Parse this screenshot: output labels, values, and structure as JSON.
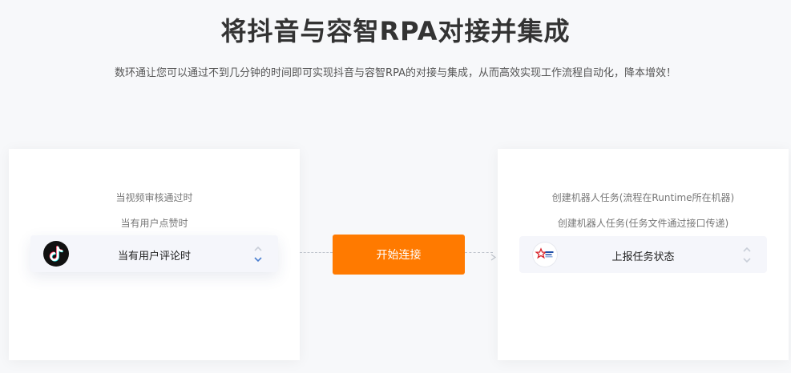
{
  "header": {
    "title": "将抖音与容智RPA对接并集成",
    "subtitle": "数环通让您可以通过不到几分钟的时间即可实现抖音与容智RPA的对接与集成，从而高效实现工作流程自动化，降本增效！"
  },
  "trigger_panel": {
    "options": [
      "当视频审核通过时",
      "当有用户点赞时"
    ],
    "selected": {
      "label": "当有用户评论时",
      "icon": "tiktok-icon"
    }
  },
  "connect_button": {
    "label": "开始连接",
    "color": "#ff7a00"
  },
  "action_panel": {
    "options": [
      "创建机器人任务(流程在Runtime所在机器)",
      "创建机器人任务(任务文件通过接口传递)"
    ],
    "selected": {
      "label": "上报任务状态",
      "icon": "robot-icon"
    }
  }
}
